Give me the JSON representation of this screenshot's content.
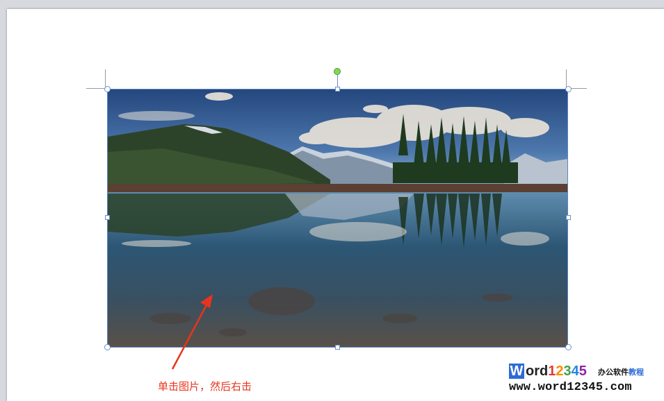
{
  "document": {
    "image_alt": "Mountain lake landscape photo",
    "caption": "单击图片，然后右击"
  },
  "colors": {
    "selection_border": "#5b86c7",
    "rotate_handle": "#7ed957",
    "caption": "#e8341c",
    "arrow": "#e8341c",
    "logo_blue": "#2d6bd6"
  },
  "icons": {
    "rotate": "rotate-handle-icon",
    "arrow": "red-arrow-icon"
  },
  "watermark": {
    "w": "W",
    "ord": "ord",
    "n1": "1",
    "n2": "2",
    "n3": "3",
    "n4": "4",
    "n5": "5",
    "tag_black": "办公软件",
    "tag_blue": "教程",
    "url": "www.word12345.com"
  }
}
